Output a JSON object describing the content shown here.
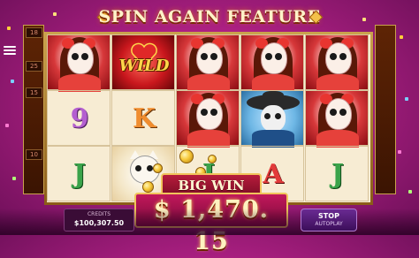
{
  "header": {
    "title": "SPIN AGAIN FEATURE"
  },
  "paylines": {
    "left": [
      "18",
      "25",
      "15",
      "10"
    ],
    "right": []
  },
  "reels": {
    "symbols": [
      [
        "lady",
        "letter-9",
        "letter-J"
      ],
      [
        "wild",
        "letter-K",
        "cat"
      ],
      [
        "lady",
        "lady",
        "letter-I"
      ],
      [
        "lady",
        "mariachi",
        "letter-A"
      ],
      [
        "lady",
        "lady",
        "letter-J"
      ]
    ],
    "letters": {
      "r0c1": "9",
      "r0c2": "J",
      "r1c1": "K",
      "r2c2": "J",
      "r3c2": "A",
      "r4c2": "J"
    },
    "wild_label": "WILD"
  },
  "win": {
    "label": "BIG WIN",
    "amount": "$ 1,470. 15"
  },
  "footer": {
    "credits_label": "CREDITS",
    "credits_value": "$100,307.50",
    "stop_label": "STOP",
    "stop_sub": "AUTOPLAY"
  },
  "colors": {
    "background": "#a91f80",
    "gold": "#f1c45b",
    "banner": "#c2185b"
  },
  "icons": [
    "menu-icon",
    "heart-icon",
    "coin-icon"
  ]
}
